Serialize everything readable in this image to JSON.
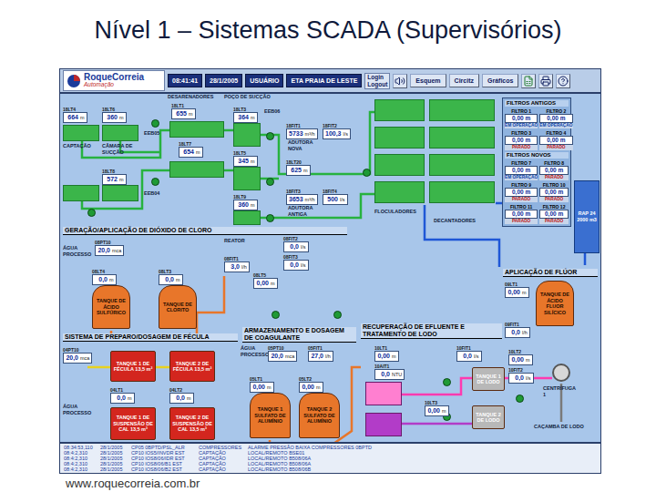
{
  "slide": {
    "title": "Nível 1 – Sistemas SCADA (Supervisórios)",
    "url": "www.roquecorreia.com.br"
  },
  "toolbar": {
    "logo": "RoqueCorreia",
    "logo_sub": "Automação",
    "time": "08:41:41",
    "date": "28/1/2005",
    "user": "USUÁRIO",
    "station": "ETA PRAIA DE LESTE",
    "login": "Login",
    "logout": "Logout",
    "buttons": [
      "Esquem",
      "Circitz",
      "Gráficos"
    ]
  },
  "sections": [
    "GERAÇÃO/APLICAÇÃO DE DIÓXIDO DE CLORO",
    "APLICAÇÃO DE FLÚOR",
    "SISTEMA DE PREPARO/DOSAGEM DE FÉCULA",
    "ARMAZENAMENTO E DOSAGEM DE COAGULANTE",
    "RECUPERAÇÃO DE EFLUENTE E TRATAMENTO DE LODO"
  ],
  "labels": [
    "DESARENADORES",
    "POÇO DE SUCÇÃO",
    "CAPTAÇÃO",
    "CÂMARA DE SUCÇÃO",
    "EEB05",
    "EEB06",
    "ADUTORA NOVA",
    "ADUTORA ANTIGA",
    "FLOCULADORES",
    "DECANTADORES",
    "ÁGUA PROCESSO",
    "REATOR",
    "ÁGUA PROCESSO",
    "ÁGUA PROCESSO",
    "CENTRÍFUGA 1",
    "CAÇAMBA DE LODO",
    "EEB04"
  ],
  "readouts": [
    {
      "tag": "18LT4",
      "value": "664",
      "unit": "m"
    },
    {
      "tag": "18LT6",
      "value": "360",
      "unit": "m"
    },
    {
      "tag": "18LT1",
      "value": "655",
      "unit": "m"
    },
    {
      "tag": "18LT3",
      "value": "364",
      "unit": "m"
    },
    {
      "tag": "18LT7",
      "value": "654",
      "unit": "m"
    },
    {
      "tag": "18LT5",
      "value": "345",
      "unit": "m"
    },
    {
      "tag": "18LT8",
      "value": "572",
      "unit": "m"
    },
    {
      "tag": "18LT9",
      "value": "360",
      "unit": "m"
    },
    {
      "tag": "18FIT1",
      "value": "5733",
      "unit": "m³/h"
    },
    {
      "tag": "18FIT2",
      "value": "100,3",
      "unit": "l/s"
    },
    {
      "tag": "18LT20",
      "value": "625",
      "unit": "m"
    },
    {
      "tag": "18FIT3",
      "value": "3653",
      "unit": "m³/h"
    },
    {
      "tag": "18FIT4",
      "value": "500",
      "unit": "l/s"
    },
    {
      "tag": "08PT10",
      "value": "20,0",
      "unit": "mca"
    },
    {
      "tag": "08FIT1",
      "value": "3,0",
      "unit": "l/h"
    },
    {
      "tag": "08FIT2",
      "value": "0,0",
      "unit": "l/s"
    },
    {
      "tag": "08FIT3",
      "value": "0,0",
      "unit": "l/s"
    },
    {
      "tag": "08LT5",
      "value": "0,00",
      "unit": "m"
    },
    {
      "tag": "08LT4",
      "value": "0,0",
      "unit": "m"
    },
    {
      "tag": "08LT3",
      "value": "0,0",
      "unit": "m"
    },
    {
      "tag": "09LT1",
      "value": "0,00",
      "unit": "m"
    },
    {
      "tag": "09FIT1",
      "value": "0,0",
      "unit": "l/h"
    },
    {
      "tag": "04PT10",
      "value": "20,0",
      "unit": "mca"
    },
    {
      "tag": "04LT1",
      "value": "0,0",
      "unit": "m"
    },
    {
      "tag": "04LT2",
      "value": "0,0",
      "unit": "m"
    },
    {
      "tag": "05PT10",
      "value": "20,0",
      "unit": "mca"
    },
    {
      "tag": "05FIT1",
      "value": "27,0",
      "unit": "l/h"
    },
    {
      "tag": "05LT1",
      "value": "0,00",
      "unit": "m"
    },
    {
      "tag": "05LT2",
      "value": "0,00",
      "unit": "m"
    },
    {
      "tag": "10LT1",
      "value": "0,00",
      "unit": "m"
    },
    {
      "tag": "10AIT1",
      "value": "0,0",
      "unit": "NTU"
    },
    {
      "tag": "10FIT1",
      "value": "0,0",
      "unit": "l/s"
    },
    {
      "tag": "10LT2",
      "value": "0,00",
      "unit": "m"
    },
    {
      "tag": "10FIT2",
      "value": "0,0",
      "unit": "l/s"
    },
    {
      "tag": "10LT3",
      "value": "0,00",
      "unit": "m"
    }
  ],
  "tanks": [
    {
      "label": "TANQUE DE ÁCIDO SULFÚRICO",
      "kind": "silo",
      "color": "#e8762a"
    },
    {
      "label": "TANQUE DE CLORITO",
      "kind": "silo",
      "color": "#e8762a"
    },
    {
      "label": "TANQUE DE ÁCIDO FLUOR SILÍCICO",
      "kind": "silo",
      "color": "#e8762a"
    },
    {
      "label": "TANQUE 1 DE FÉCULA 13,5 m³",
      "kind": "box",
      "color": "#d3261e"
    },
    {
      "label": "TANQUE 2 DE FÉCULA 13,5 m³",
      "kind": "box",
      "color": "#d3261e"
    },
    {
      "label": "TANQUE 1 DE SUSPENSÃO DE CAL 13,5 m³",
      "kind": "box",
      "color": "#d3261e"
    },
    {
      "label": "TANQUE 2 DE SUSPENSÃO DE CAL 13,5 m³",
      "kind": "box",
      "color": "#d3261e"
    },
    {
      "label": "TANQUE 1 SULFATO DE ALUMÍNIO",
      "kind": "silo",
      "color": "#e8762a"
    },
    {
      "label": "TANQUE 2 SULFATO DE ALUMÍNIO",
      "kind": "silo",
      "color": "#e8762a"
    },
    {
      "label": "TANQUE 1 DE LODO",
      "kind": "box",
      "color": "#b8b8b8"
    },
    {
      "label": "TANQUE 2 DE LODO",
      "kind": "box",
      "color": "#b8b8b8"
    }
  ],
  "filters": [
    {
      "title": "FILTROS ANTIGOS",
      "items": [
        {
          "name": "FILTRO 1",
          "value": "0,00",
          "unit": "m",
          "status": "EM OPERAÇÃO",
          "running": true
        },
        {
          "name": "FILTRO 2",
          "value": "0,00",
          "unit": "m",
          "status": "EM OPERAÇÃO",
          "running": true
        },
        {
          "name": "FILTRO 3",
          "value": "0,00",
          "unit": "m",
          "status": "PARADO",
          "running": false
        },
        {
          "name": "FILTRO 4",
          "value": "0,00",
          "unit": "m",
          "status": "PARADO",
          "running": false
        }
      ]
    },
    {
      "title": "FILTROS NOVOS",
      "items": [
        {
          "name": "FILTRO 7",
          "value": "0,00",
          "unit": "m",
          "status": "EM OPERAÇÃO",
          "running": true
        },
        {
          "name": "FILTRO 8",
          "value": "0,00",
          "unit": "m",
          "status": "PARADO",
          "running": false
        },
        {
          "name": "FILTRO 9",
          "value": "0,00",
          "unit": "m",
          "status": "PARADO",
          "running": false
        },
        {
          "name": "FILTRO 10",
          "value": "0,00",
          "unit": "m",
          "status": "PARADO",
          "running": false
        },
        {
          "name": "FILTRO 11",
          "value": "0,00",
          "unit": "m",
          "status": "PARADO",
          "running": false
        },
        {
          "name": "FILTRO 12",
          "value": "0,00",
          "unit": "m",
          "status": "PARADO",
          "running": false
        }
      ]
    }
  ],
  "reservoir": {
    "label": "RAP 24",
    "volume": "2000 m3"
  },
  "alarms": [
    {
      "time": "08:34:53,110",
      "date": "28/1/2005",
      "point": "CP05 0BPTD/PSL_ALR",
      "area": "COMPRESSORES",
      "message": "ALARME PRESSÃO BAIXA COMPRESSORES 0BPTD"
    },
    {
      "time": "08:4:2,310",
      "date": "28/1/2005",
      "point": "CP10 IOS5/INVDR EST",
      "area": "CAPTAÇÃO",
      "message": "LOCAL/REMOTO BSE01"
    },
    {
      "time": "08:4:2,310",
      "date": "28/1/2005",
      "point": "CP10 IOS8/06/IDR EST",
      "area": "CAPTAÇÃO",
      "message": "LOCAL/REMOTO B508/06A"
    },
    {
      "time": "08:4:2,310",
      "date": "28/1/2005",
      "point": "CP10 IOS8/06/B1 EST",
      "area": "CAPTAÇÃO",
      "message": "LOCAL/REMOTO B508/06A"
    },
    {
      "time": "08:4:2,310",
      "date": "28/1/2005",
      "point": "CP10 IOS8/06/B2 EST",
      "area": "CAPTAÇÃO",
      "message": "LOCAL/REMOTO B508/06B"
    }
  ]
}
